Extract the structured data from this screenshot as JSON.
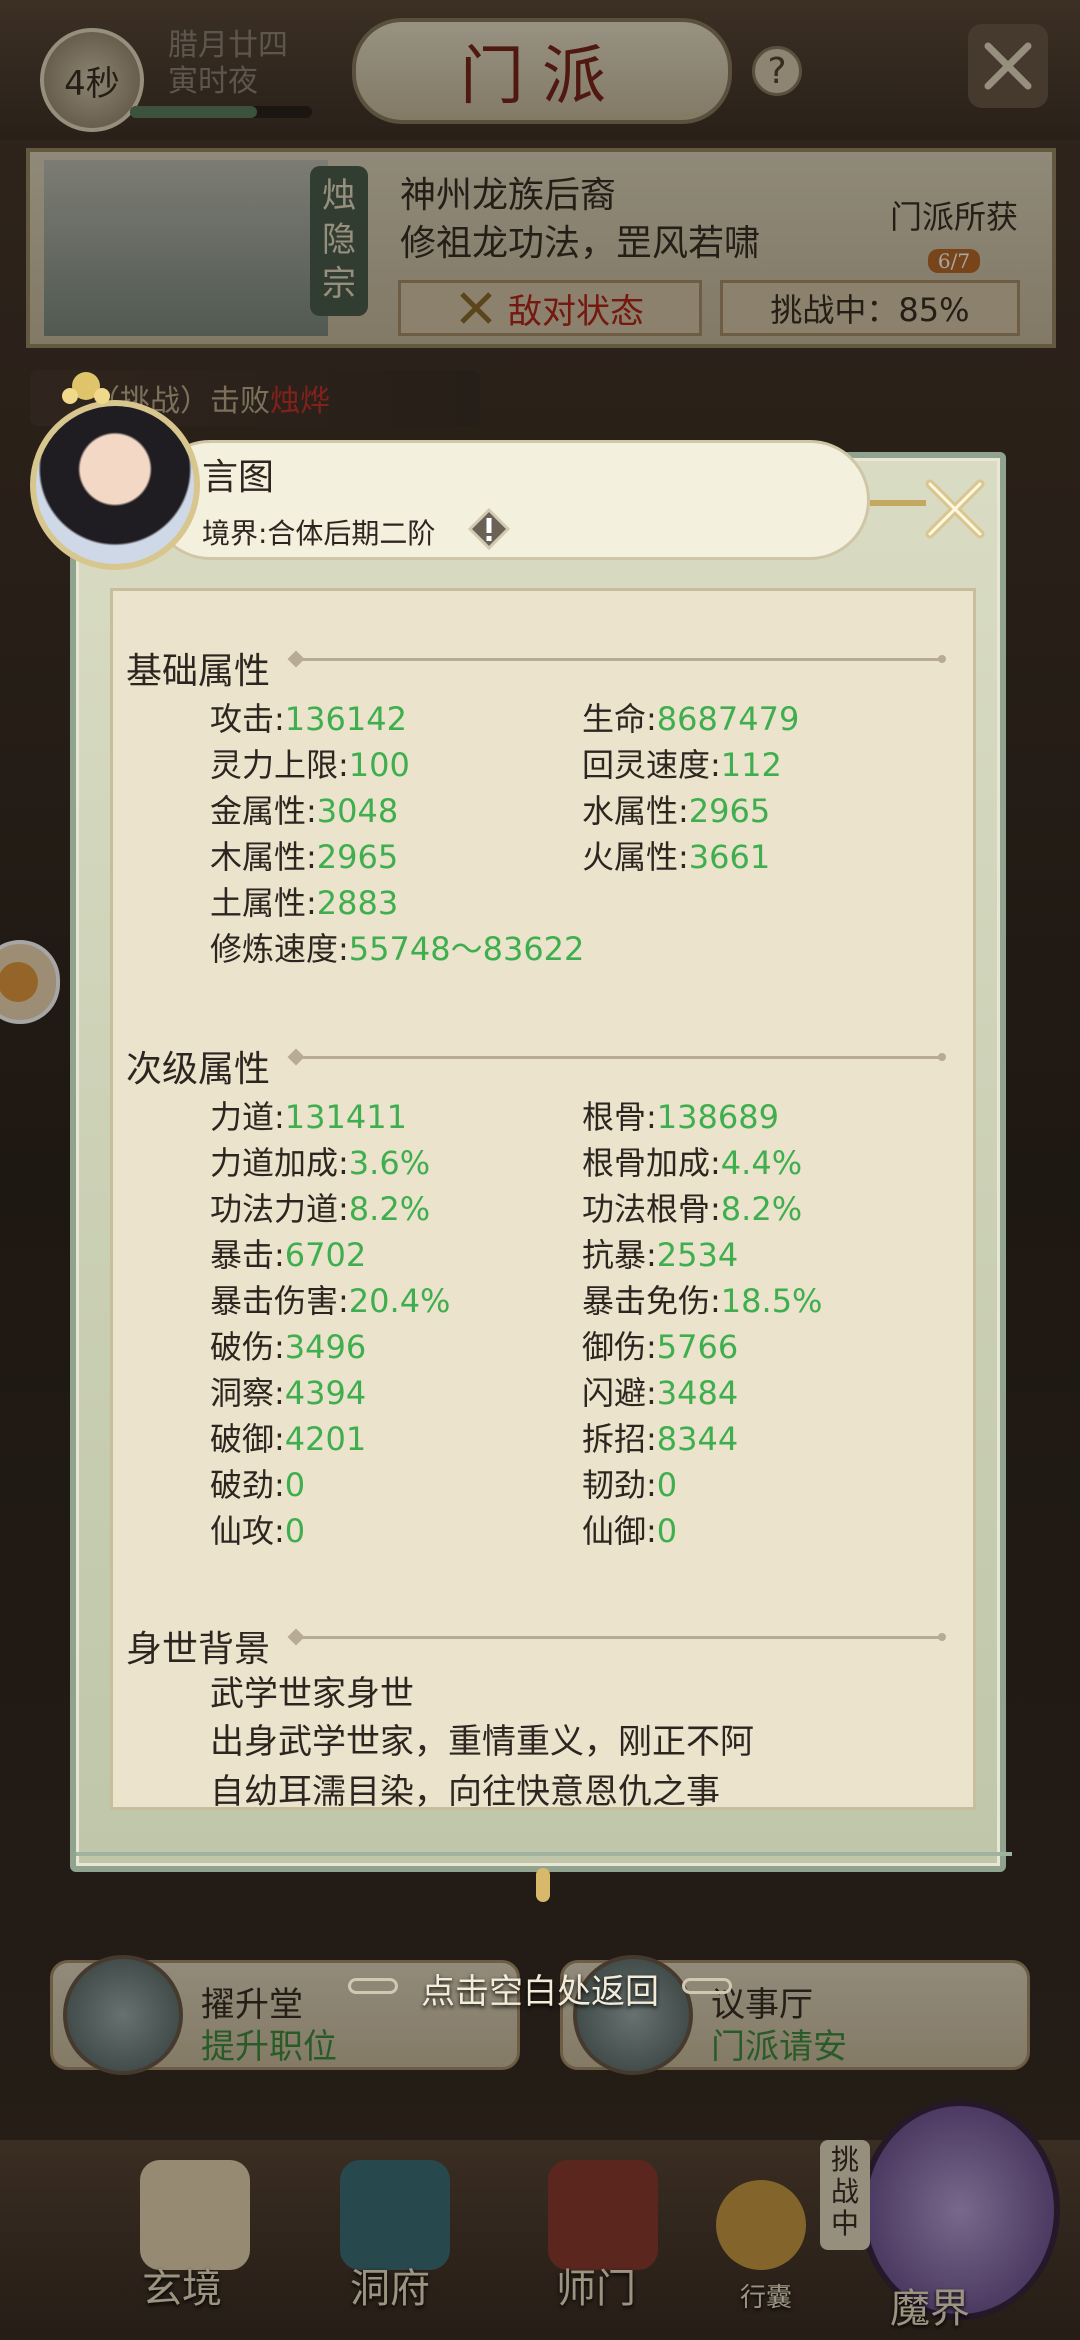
{
  "topbar": {
    "timer": "4秒",
    "date_line1": "腊月廿四",
    "date_line2": "寅时夜",
    "title": "门派",
    "help": "?"
  },
  "sect": {
    "tag": "烛隐宗",
    "desc_line1": "神州龙族后裔",
    "desc_line2": "修祖龙功法，罡风若啸",
    "prize_label": "门派所获",
    "prize_count": "6/7",
    "hostile_label": "敌对状态",
    "challenge_status": "挑战中：85%"
  },
  "event": {
    "prefix": "（挑战）击败",
    "target": "烛烨"
  },
  "character": {
    "name": "言图",
    "realm": "境界:合体后期二阶"
  },
  "basic": {
    "title": "基础属性",
    "items": [
      {
        "label": "攻击",
        "value": "136142"
      },
      {
        "label": "生命",
        "value": "8687479"
      },
      {
        "label": "灵力上限",
        "value": "100"
      },
      {
        "label": "回灵速度",
        "value": "112"
      },
      {
        "label": "金属性",
        "value": "3048"
      },
      {
        "label": "水属性",
        "value": "2965"
      },
      {
        "label": "木属性",
        "value": "2965"
      },
      {
        "label": "火属性",
        "value": "3661"
      },
      {
        "label": "土属性",
        "value": "2883"
      },
      {
        "label": "修炼速度",
        "value": "55748～83622"
      }
    ]
  },
  "secondary": {
    "title": "次级属性",
    "items": [
      {
        "label": "力道",
        "value": "131411"
      },
      {
        "label": "根骨",
        "value": "138689"
      },
      {
        "label": "力道加成",
        "value": "3.6%"
      },
      {
        "label": "根骨加成",
        "value": "4.4%"
      },
      {
        "label": "功法力道",
        "value": "8.2%"
      },
      {
        "label": "功法根骨",
        "value": "8.2%"
      },
      {
        "label": "暴击",
        "value": "6702"
      },
      {
        "label": "抗暴",
        "value": "2534"
      },
      {
        "label": "暴击伤害",
        "value": "20.4%"
      },
      {
        "label": "暴击免伤",
        "value": "18.5%"
      },
      {
        "label": "破伤",
        "value": "3496"
      },
      {
        "label": "御伤",
        "value": "5766"
      },
      {
        "label": "洞察",
        "value": "4394"
      },
      {
        "label": "闪避",
        "value": "3484"
      },
      {
        "label": "破御",
        "value": "4201"
      },
      {
        "label": "拆招",
        "value": "8344"
      },
      {
        "label": "破劲",
        "value": "0"
      },
      {
        "label": "韧劲",
        "value": "0"
      },
      {
        "label": "仙攻",
        "value": "0"
      },
      {
        "label": "仙御",
        "value": "0"
      }
    ]
  },
  "background": {
    "title": "身世背景",
    "lines": [
      "武学世家身世",
      "出身武学世家，重情重义，刚正不阿",
      "自幼耳濡目染，向往快意恩仇之事"
    ]
  },
  "hint": "点击空白处返回",
  "cards": [
    {
      "title": "擢升堂",
      "sub": "提升职位"
    },
    {
      "title": "议事厅",
      "sub": "门派请安"
    }
  ],
  "nav": {
    "items": [
      "玄境",
      "洞府",
      "师门",
      "行囊",
      "魔界"
    ],
    "challenge_vertical": "挑战中"
  },
  "colors": {
    "value_green": "#3fae4e",
    "accent_red": "#b3261a",
    "panel_bg": "#ebe3cc"
  }
}
